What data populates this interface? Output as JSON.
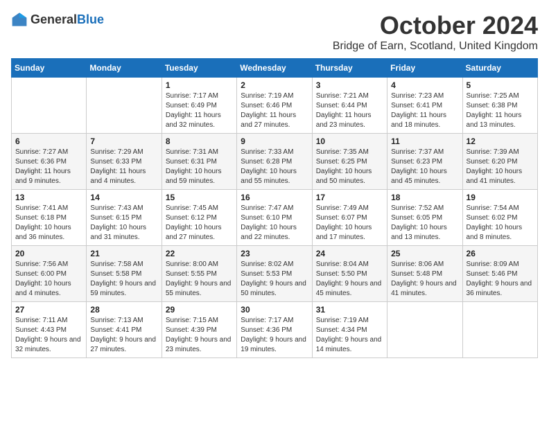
{
  "header": {
    "logo_general": "General",
    "logo_blue": "Blue",
    "month_title": "October 2024",
    "location": "Bridge of Earn, Scotland, United Kingdom"
  },
  "weekdays": [
    "Sunday",
    "Monday",
    "Tuesday",
    "Wednesday",
    "Thursday",
    "Friday",
    "Saturday"
  ],
  "weeks": [
    [
      {
        "day": "",
        "info": ""
      },
      {
        "day": "",
        "info": ""
      },
      {
        "day": "1",
        "info": "Sunrise: 7:17 AM\nSunset: 6:49 PM\nDaylight: 11 hours and 32 minutes."
      },
      {
        "day": "2",
        "info": "Sunrise: 7:19 AM\nSunset: 6:46 PM\nDaylight: 11 hours and 27 minutes."
      },
      {
        "day": "3",
        "info": "Sunrise: 7:21 AM\nSunset: 6:44 PM\nDaylight: 11 hours and 23 minutes."
      },
      {
        "day": "4",
        "info": "Sunrise: 7:23 AM\nSunset: 6:41 PM\nDaylight: 11 hours and 18 minutes."
      },
      {
        "day": "5",
        "info": "Sunrise: 7:25 AM\nSunset: 6:38 PM\nDaylight: 11 hours and 13 minutes."
      }
    ],
    [
      {
        "day": "6",
        "info": "Sunrise: 7:27 AM\nSunset: 6:36 PM\nDaylight: 11 hours and 9 minutes."
      },
      {
        "day": "7",
        "info": "Sunrise: 7:29 AM\nSunset: 6:33 PM\nDaylight: 11 hours and 4 minutes."
      },
      {
        "day": "8",
        "info": "Sunrise: 7:31 AM\nSunset: 6:31 PM\nDaylight: 10 hours and 59 minutes."
      },
      {
        "day": "9",
        "info": "Sunrise: 7:33 AM\nSunset: 6:28 PM\nDaylight: 10 hours and 55 minutes."
      },
      {
        "day": "10",
        "info": "Sunrise: 7:35 AM\nSunset: 6:25 PM\nDaylight: 10 hours and 50 minutes."
      },
      {
        "day": "11",
        "info": "Sunrise: 7:37 AM\nSunset: 6:23 PM\nDaylight: 10 hours and 45 minutes."
      },
      {
        "day": "12",
        "info": "Sunrise: 7:39 AM\nSunset: 6:20 PM\nDaylight: 10 hours and 41 minutes."
      }
    ],
    [
      {
        "day": "13",
        "info": "Sunrise: 7:41 AM\nSunset: 6:18 PM\nDaylight: 10 hours and 36 minutes."
      },
      {
        "day": "14",
        "info": "Sunrise: 7:43 AM\nSunset: 6:15 PM\nDaylight: 10 hours and 31 minutes."
      },
      {
        "day": "15",
        "info": "Sunrise: 7:45 AM\nSunset: 6:12 PM\nDaylight: 10 hours and 27 minutes."
      },
      {
        "day": "16",
        "info": "Sunrise: 7:47 AM\nSunset: 6:10 PM\nDaylight: 10 hours and 22 minutes."
      },
      {
        "day": "17",
        "info": "Sunrise: 7:49 AM\nSunset: 6:07 PM\nDaylight: 10 hours and 17 minutes."
      },
      {
        "day": "18",
        "info": "Sunrise: 7:52 AM\nSunset: 6:05 PM\nDaylight: 10 hours and 13 minutes."
      },
      {
        "day": "19",
        "info": "Sunrise: 7:54 AM\nSunset: 6:02 PM\nDaylight: 10 hours and 8 minutes."
      }
    ],
    [
      {
        "day": "20",
        "info": "Sunrise: 7:56 AM\nSunset: 6:00 PM\nDaylight: 10 hours and 4 minutes."
      },
      {
        "day": "21",
        "info": "Sunrise: 7:58 AM\nSunset: 5:58 PM\nDaylight: 9 hours and 59 minutes."
      },
      {
        "day": "22",
        "info": "Sunrise: 8:00 AM\nSunset: 5:55 PM\nDaylight: 9 hours and 55 minutes."
      },
      {
        "day": "23",
        "info": "Sunrise: 8:02 AM\nSunset: 5:53 PM\nDaylight: 9 hours and 50 minutes."
      },
      {
        "day": "24",
        "info": "Sunrise: 8:04 AM\nSunset: 5:50 PM\nDaylight: 9 hours and 45 minutes."
      },
      {
        "day": "25",
        "info": "Sunrise: 8:06 AM\nSunset: 5:48 PM\nDaylight: 9 hours and 41 minutes."
      },
      {
        "day": "26",
        "info": "Sunrise: 8:09 AM\nSunset: 5:46 PM\nDaylight: 9 hours and 36 minutes."
      }
    ],
    [
      {
        "day": "27",
        "info": "Sunrise: 7:11 AM\nSunset: 4:43 PM\nDaylight: 9 hours and 32 minutes."
      },
      {
        "day": "28",
        "info": "Sunrise: 7:13 AM\nSunset: 4:41 PM\nDaylight: 9 hours and 27 minutes."
      },
      {
        "day": "29",
        "info": "Sunrise: 7:15 AM\nSunset: 4:39 PM\nDaylight: 9 hours and 23 minutes."
      },
      {
        "day": "30",
        "info": "Sunrise: 7:17 AM\nSunset: 4:36 PM\nDaylight: 9 hours and 19 minutes."
      },
      {
        "day": "31",
        "info": "Sunrise: 7:19 AM\nSunset: 4:34 PM\nDaylight: 9 hours and 14 minutes."
      },
      {
        "day": "",
        "info": ""
      },
      {
        "day": "",
        "info": ""
      }
    ]
  ]
}
